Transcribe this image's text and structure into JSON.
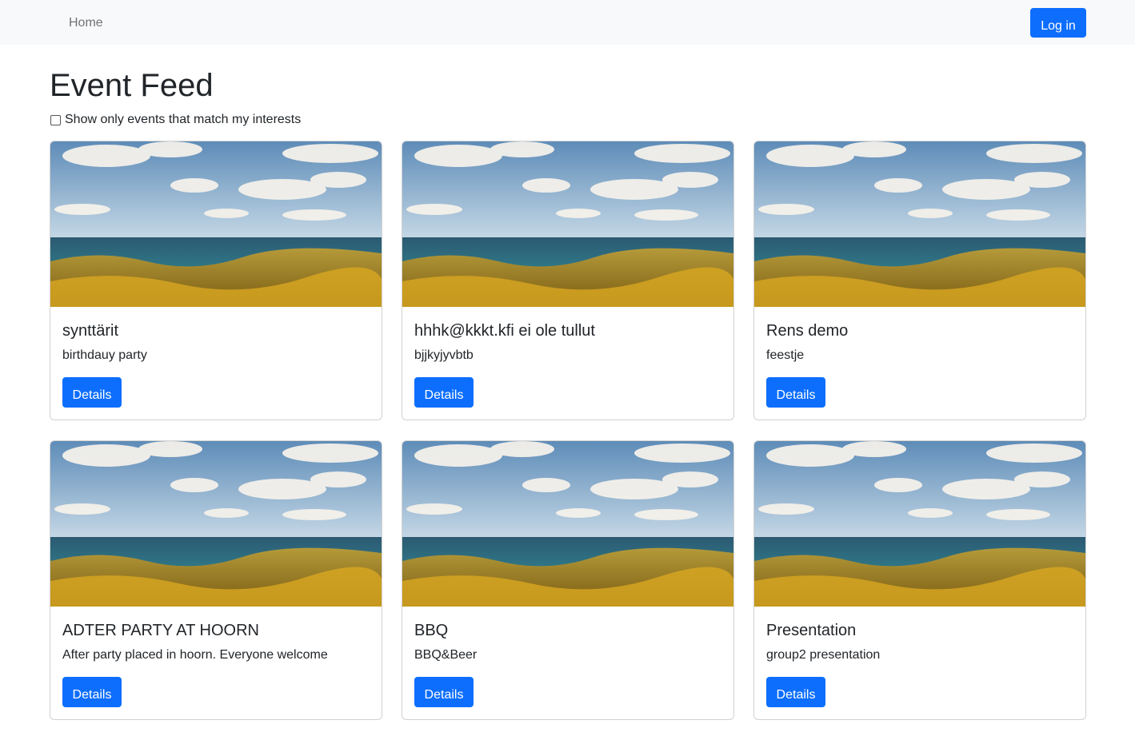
{
  "navbar": {
    "home_label": "Home",
    "login_label": "Log in"
  },
  "page": {
    "title": "Event Feed",
    "filter_label": "Show only events that match my interests"
  },
  "colors": {
    "primary": "#0d6efd",
    "navbar_bg": "#f8f9fa"
  },
  "events": [
    {
      "title": "synttärit",
      "description": "birthdauy party",
      "button_label": "Details"
    },
    {
      "title": "hhhk@kkkt.kfi ei ole tullut",
      "description": "bjjkyjyvbtb",
      "button_label": "Details"
    },
    {
      "title": "Rens demo",
      "description": "feestje",
      "button_label": "Details"
    },
    {
      "title": "ADTER PARTY AT HOORN",
      "description": "After party placed in hoorn. Everyone welcome",
      "button_label": "Details"
    },
    {
      "title": "BBQ",
      "description": "BBQ&Beer",
      "button_label": "Details"
    },
    {
      "title": "Presentation",
      "description": "group2 presentation",
      "button_label": "Details"
    }
  ]
}
